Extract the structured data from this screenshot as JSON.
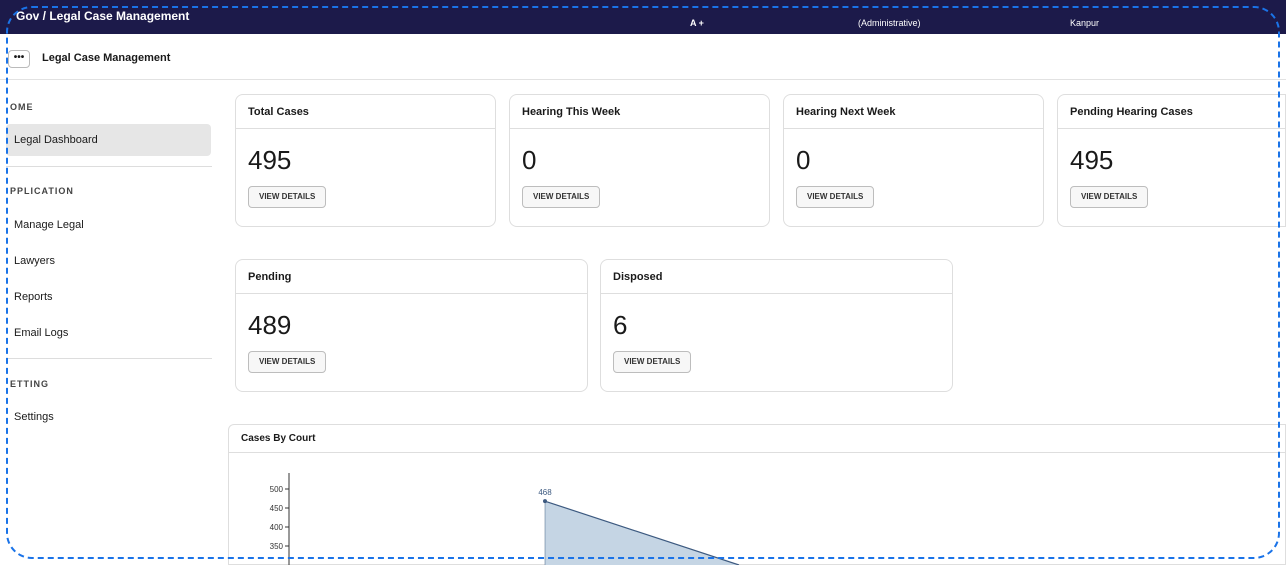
{
  "topbar": {
    "breadcrumb": "Gov  /  Legal Case Management",
    "info1": "A +",
    "info2": "(Administrative)",
    "info3": "Kanpur"
  },
  "subbar": {
    "menu_icon": "more-dots-icon",
    "title": "Legal Case Management"
  },
  "sidebar": {
    "sections": [
      {
        "label": "OME",
        "items": [
          "Legal Dashboard"
        ]
      },
      {
        "label": "PPLICATION",
        "items": [
          "Manage Legal",
          "Lawyers",
          "Reports",
          "Email Logs"
        ]
      },
      {
        "label": "ETTING",
        "items": [
          "Settings"
        ]
      }
    ],
    "active": "Legal Dashboard"
  },
  "cards": [
    {
      "title": "Total Cases",
      "value": "495",
      "button": "VIEW DETAILS"
    },
    {
      "title": "Hearing This Week",
      "value": "0",
      "button": "VIEW DETAILS"
    },
    {
      "title": "Hearing Next Week",
      "value": "0",
      "button": "VIEW DETAILS"
    },
    {
      "title": "Pending Hearing Cases",
      "value": "495",
      "button": "VIEW DETAILS"
    },
    {
      "title": "Pending",
      "value": "489",
      "button": "VIEW DETAILS"
    },
    {
      "title": "Disposed",
      "value": "6",
      "button": "VIEW DETAILS"
    }
  ],
  "chart_data": {
    "type": "area",
    "title": "Cases By Court",
    "yticks": [
      350,
      400,
      450,
      500
    ],
    "ylim": [
      300,
      520
    ],
    "points": [
      {
        "x": 0,
        "y": 468,
        "label": "468"
      },
      {
        "x": 1,
        "y": 300
      }
    ],
    "fill_color": "#c5d5e4",
    "line_color": "#3d5a80"
  },
  "colors": {
    "topbar": "#1c1a4a",
    "accent_frame": "#1a73e8"
  }
}
